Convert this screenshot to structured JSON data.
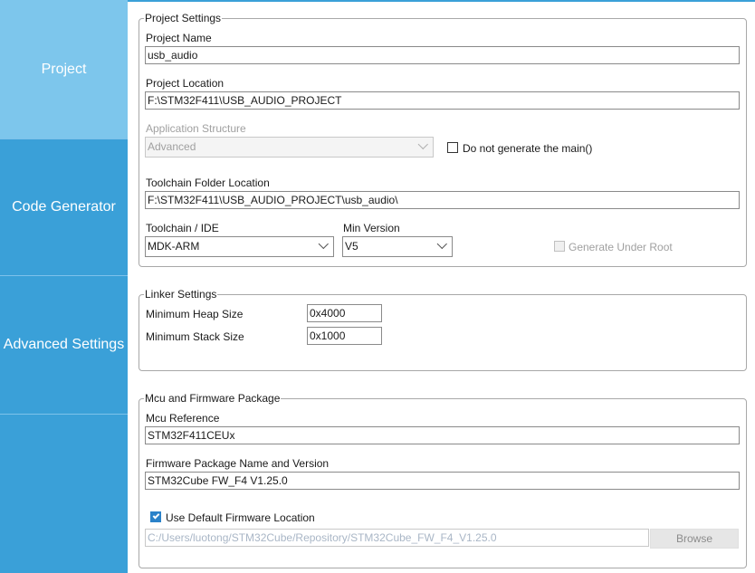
{
  "sidebar": {
    "items": [
      {
        "label": "Project",
        "active": true
      },
      {
        "label": "Code Generator",
        "active": false
      },
      {
        "label": "Advanced Settings",
        "active": false
      },
      {
        "label": "",
        "active": false
      }
    ]
  },
  "project_settings": {
    "legend": "Project Settings",
    "project_name_label": "Project Name",
    "project_name": "usb_audio",
    "project_location_label": "Project Location",
    "project_location": "F:\\STM32F411\\USB_AUDIO_PROJECT",
    "app_structure_label": "Application Structure",
    "app_structure_value": "Advanced",
    "no_main_label": "Do not generate the main()",
    "no_main_checked": false,
    "toolchain_folder_label": "Toolchain Folder Location",
    "toolchain_folder": "F:\\STM32F411\\USB_AUDIO_PROJECT\\usb_audio\\",
    "toolchain_ide_label": "Toolchain / IDE",
    "toolchain_ide_value": "MDK-ARM",
    "min_version_label": "Min Version",
    "min_version_value": "V5",
    "generate_under_root_label": "Generate Under Root",
    "generate_under_root_checked": false
  },
  "linker_settings": {
    "legend": "Linker Settings",
    "heap_label": "Minimum Heap Size",
    "heap_value": "0x4000",
    "stack_label": "Minimum Stack Size",
    "stack_value": "0x1000"
  },
  "mcu_firmware": {
    "legend": "Mcu and Firmware Package",
    "mcu_ref_label": "Mcu Reference",
    "mcu_ref": "STM32F411CEUx",
    "fw_pkg_label": "Firmware Package Name and Version",
    "fw_pkg": "STM32Cube FW_F4 V1.25.0",
    "use_default_label": "Use Default Firmware Location",
    "use_default_checked": true,
    "fw_location": "C:/Users/luotong/STM32Cube/Repository/STM32Cube_FW_F4_V1.25.0",
    "browse_label": "Browse"
  },
  "colors": {
    "sidebar": "#3aa0d8",
    "sidebar_active": "#7dc6ec",
    "checkbox_checked": "#2b82c9"
  }
}
